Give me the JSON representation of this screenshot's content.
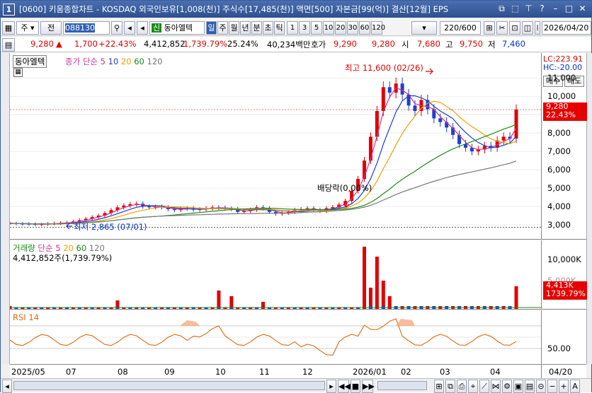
{
  "title": {
    "window_num": "1",
    "text": "[0600] 키움종합차트 - KOSDAQ 외국인보유[1,008(천)] 주식수[17,485(천)] 액면[500] 자본금[99(억)] 결산[12월] EPS"
  },
  "toolbar": {
    "period": "주",
    "prev": "전",
    "code": "088130",
    "market_badge": "신",
    "stock_name": "동아엘텍",
    "tabs": [
      "일",
      "주",
      "월",
      "년",
      "분",
      "초",
      "틱"
    ],
    "intervals": [
      "1",
      "3",
      "5",
      "10",
      "20",
      "30",
      "60",
      "120"
    ],
    "count": "220",
    "total": "/600",
    "date": "2026/04/20"
  },
  "quote": {
    "price": "9,280",
    "arrow": "▲",
    "change": "1,700",
    "change_pct": "+22.43%",
    "volume": "4,412,852",
    "volume_pct": "1,739.79%",
    "turnover": "25.24%",
    "amount": "40,234백만",
    "hoga_label": "호가",
    "hoga1": "9,290",
    "hoga2": "9,280",
    "open_label": "시",
    "open": "7,680",
    "high_label": "고",
    "high": "9,750",
    "low_label": "저",
    "low": "7,460"
  },
  "price_panel": {
    "stock_tag": "동아엘텍",
    "ma_title": "종가 단순",
    "ma_periods": [
      "5",
      "10",
      "20",
      "60",
      "120"
    ],
    "ma_colors": [
      "#cc3399",
      "#1f3fd0",
      "#f0a000",
      "#1a8a1a",
      "#777777"
    ],
    "high_note": "최고 11,600 (02/26)",
    "low_note": "최저 2,865 (07/01)",
    "div_note": "배당락(0,00%)",
    "lc": "LC:223.91",
    "hc": "HC:-20.00",
    "buy_btn": "매수",
    "sell_btn": "매도",
    "current_price": "9,280",
    "current_pct": "22.43%",
    "y_ticks": [
      "11,000",
      "10,000",
      "9,000",
      "8,000",
      "7,000",
      "6,000",
      "5,000",
      "4,000",
      "3,000"
    ]
  },
  "volume_panel": {
    "title": "거래량",
    "ma_title": "단순",
    "ma_periods": [
      "5",
      "20",
      "60",
      "120"
    ],
    "ma_colors": [
      "#cc3399",
      "#f0a000",
      "#1a8a1a",
      "#777777"
    ],
    "value_text": "4,412,852주(1,739.79%)",
    "y_tick": "10,000K",
    "y_tick2": "5,000K",
    "current": "4,413K",
    "current_pct": "1739.79%"
  },
  "rsi_panel": {
    "title": "RSI 14",
    "y_tick": "50.00"
  },
  "x_axis": {
    "labels": [
      "2025/05",
      "07",
      "08",
      "09",
      "10",
      "11",
      "12",
      "2026/01",
      "02",
      "03",
      "04"
    ],
    "right_label": "04/20"
  },
  "chart_data": {
    "type": "candlestick",
    "title": "",
    "y_ticks": [
      3000,
      4000,
      5000,
      6000,
      7000,
      8000,
      9000,
      10000,
      11000
    ],
    "ylim": [
      2500,
      11900
    ],
    "highest": {
      "value": 11600,
      "date": "02/26"
    },
    "lowest": {
      "value": 2865,
      "date": "07/01"
    },
    "close_series": [
      3080,
      3060,
      3050,
      3040,
      3020,
      3030,
      3060,
      3080,
      3100,
      3120,
      3180,
      3250,
      3330,
      3420,
      3500,
      3640,
      3800,
      3950,
      4050,
      4120,
      4150,
      4000,
      3950,
      3980,
      3950,
      3850,
      3800,
      3880,
      3900,
      3820,
      3850,
      3900,
      3950,
      3930,
      3880,
      3860,
      3700,
      3750,
      3820,
      3950,
      3900,
      3700,
      3600,
      3650,
      3700,
      3800,
      3850,
      3900,
      3820,
      3750,
      3900,
      3960,
      4100,
      4300,
      4850,
      5500,
      6500,
      7800,
      9200,
      10500,
      10200,
      10700,
      10100,
      9500,
      9200,
      9800,
      9300,
      8800,
      8600,
      8300,
      7900,
      7400,
      7200,
      7000,
      7100,
      7300,
      7200,
      7600,
      7800,
      7700,
      9280
    ]
  }
}
